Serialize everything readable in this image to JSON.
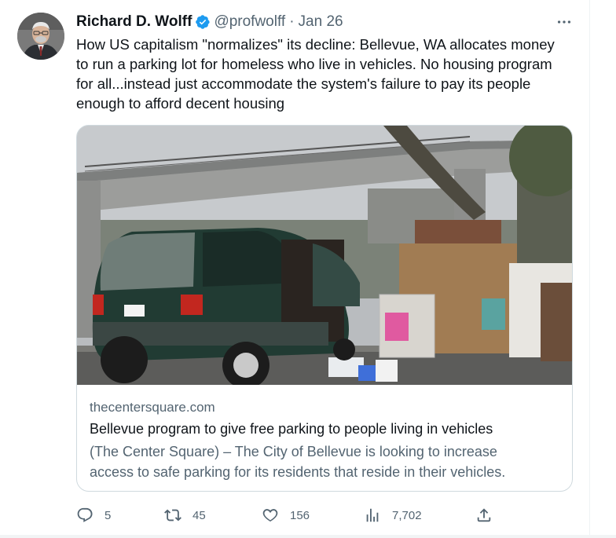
{
  "author": {
    "name": "Richard D. Wolff",
    "handle": "@profwolff",
    "separator": "·",
    "date": "Jan 26"
  },
  "tweet": {
    "text_lines": [
      "How US capitalism \"normalizes\" its decline: Bellevue, WA allocates money",
      "to run a parking lot for homeless who live in vehicles. No housing program",
      "for all...instead just accommodate the system's failure to pay its people",
      "enough to afford decent housing"
    ]
  },
  "card": {
    "domain": "thecentersquare.com",
    "title": "Bellevue program to give free parking to people living in vehicles",
    "description_lines": [
      "(The Center Square) – The City of Bellevue is looking to increase",
      "access to safe parking for its residents that reside in their vehicles."
    ],
    "image_alt": "Green minivan parked under an overpass next to a homeless encampment"
  },
  "actions": {
    "replies": "5",
    "reposts": "45",
    "likes": "156",
    "views": "7,702"
  },
  "icons": {
    "verified": "verified-badge-icon",
    "more": "more-icon",
    "reply": "reply-icon",
    "repost": "repost-icon",
    "like": "heart-icon",
    "views": "views-icon",
    "share": "share-icon"
  },
  "colors": {
    "verified": "#1d9bf0",
    "text": "#0f1419",
    "secondary": "#536471",
    "border": "#cfd9de"
  }
}
